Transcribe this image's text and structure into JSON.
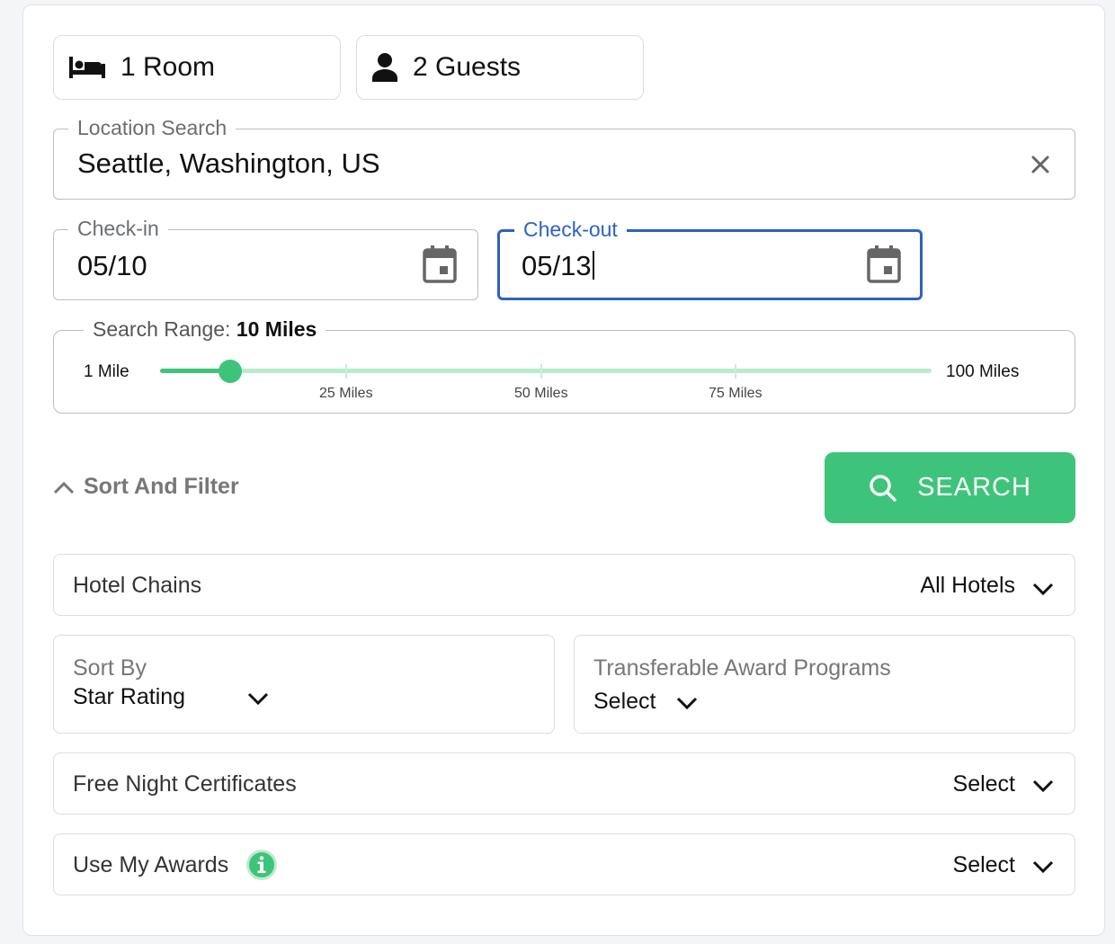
{
  "pills": {
    "rooms_label": "1 Room",
    "guests_label": "2 Guests"
  },
  "location": {
    "legend": "Location Search",
    "value": "Seattle, Washington, US"
  },
  "checkin": {
    "legend": "Check-in",
    "value": "05/10"
  },
  "checkout": {
    "legend": "Check-out",
    "value": "05/13"
  },
  "range": {
    "legend_prefix": "Search Range:",
    "legend_value": "10 Miles",
    "min_label": "1 Mile",
    "max_label": "100 Miles",
    "ticks": [
      "25 Miles",
      "50 Miles",
      "75 Miles"
    ],
    "min": 1,
    "max": 100,
    "value": 10
  },
  "sort_filter": {
    "label": "Sort And Filter"
  },
  "search_button": {
    "label": "SEARCH"
  },
  "hotel_chains": {
    "label": "Hotel Chains",
    "value": "All Hotels"
  },
  "sort_by": {
    "label": "Sort By",
    "value": "Star Rating"
  },
  "award_programs": {
    "label": "Transferable Award Programs",
    "value": "Select"
  },
  "free_night": {
    "label": "Free Night Certificates",
    "value": "Select"
  },
  "use_awards": {
    "label": "Use My Awards",
    "value": "Select"
  },
  "colors": {
    "accent": "#3ec47a",
    "focus": "#2b63c1",
    "track": "#b7eccd"
  }
}
